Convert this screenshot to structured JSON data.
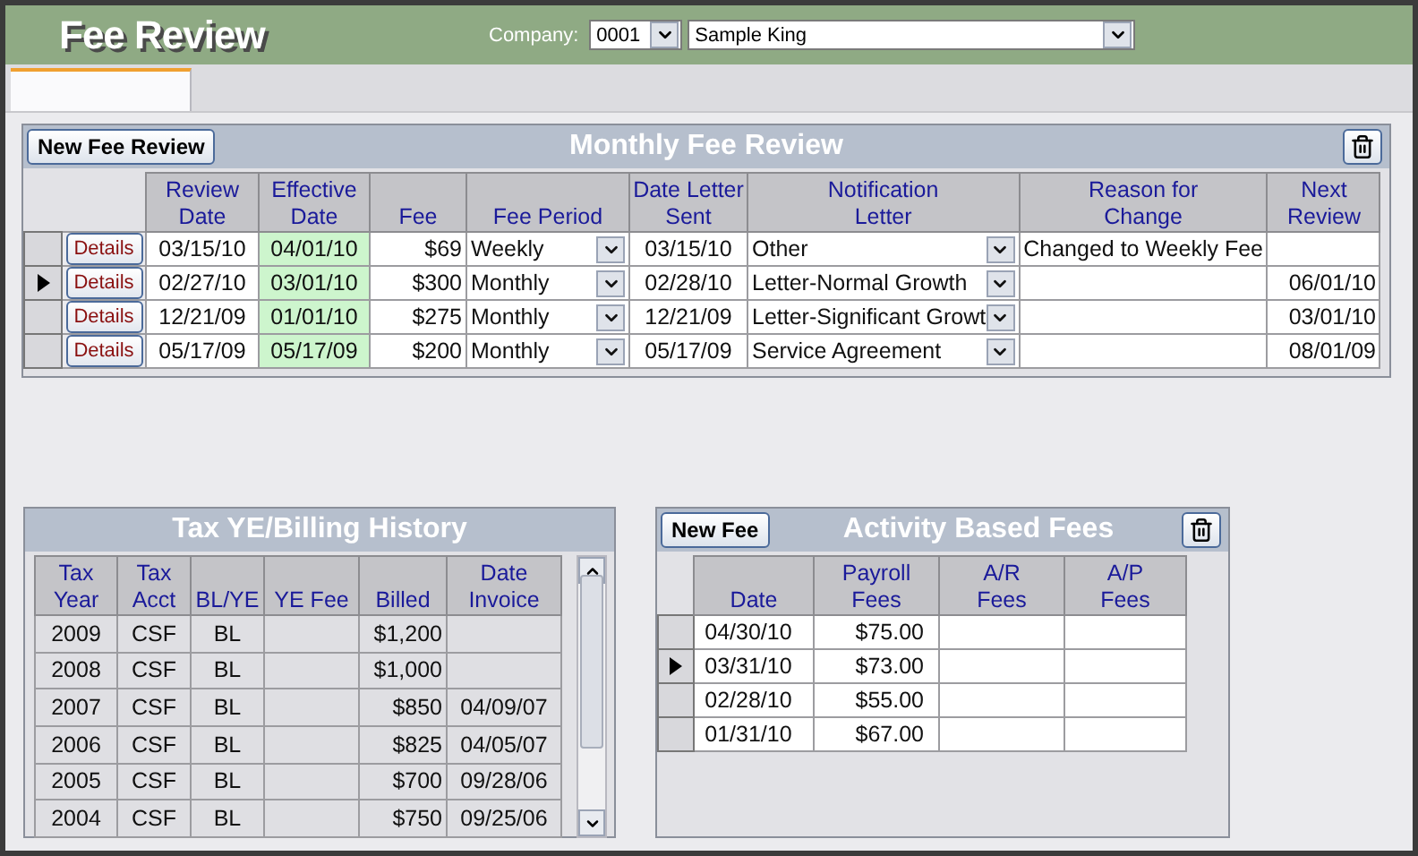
{
  "app_title": "Fee Review",
  "company": {
    "label": "Company:",
    "code": "0001",
    "name": "Sample King"
  },
  "tabs": [
    {
      "selected": true
    }
  ],
  "monthly_fee_review": {
    "title": "Monthly Fee Review",
    "new_button": "New Fee Review",
    "columns": [
      "Review\nDate",
      "Effective\nDate",
      "Fee",
      "Fee Period",
      "Date Letter\nSent",
      "Notification\nLetter",
      "Reason for\nChange",
      "Next\nReview"
    ],
    "rows": [
      {
        "current": false,
        "details": "Details",
        "review_date": "03/15/10",
        "effective_date": "04/01/10",
        "fee": "$69",
        "fee_period": "Weekly",
        "date_letter_sent": "03/15/10",
        "notification_letter": "Other",
        "reason": "Changed to Weekly Fee",
        "next_review": ""
      },
      {
        "current": true,
        "details": "Details",
        "review_date": "02/27/10",
        "effective_date": "03/01/10",
        "fee": "$300",
        "fee_period": "Monthly",
        "date_letter_sent": "02/28/10",
        "notification_letter": "Letter-Normal Growth",
        "reason": "",
        "next_review": "06/01/10"
      },
      {
        "current": false,
        "details": "Details",
        "review_date": "12/21/09",
        "effective_date": "01/01/10",
        "fee": "$275",
        "fee_period": "Monthly",
        "date_letter_sent": "12/21/09",
        "notification_letter": "Letter-Significant Growt",
        "reason": "",
        "next_review": "03/01/10"
      },
      {
        "current": false,
        "details": "Details",
        "review_date": "05/17/09",
        "effective_date": "05/17/09",
        "fee": "$200",
        "fee_period": "Monthly",
        "date_letter_sent": "05/17/09",
        "notification_letter": "Service Agreement",
        "reason": "",
        "next_review": "08/01/09"
      }
    ]
  },
  "billing_history": {
    "title": "Tax YE/Billing History",
    "columns": [
      "Tax\nYear",
      "Tax\nAcct",
      "BL/YE",
      "YE Fee",
      "Billed",
      "Date\nInvoice"
    ],
    "rows": [
      [
        "2009",
        "CSF",
        "BL",
        "",
        "$1,200",
        ""
      ],
      [
        "2008",
        "CSF",
        "BL",
        "",
        "$1,000",
        ""
      ],
      [
        "2007",
        "CSF",
        "BL",
        "",
        "$850",
        "04/09/07"
      ],
      [
        "2006",
        "CSF",
        "BL",
        "",
        "$825",
        "04/05/07"
      ],
      [
        "2005",
        "CSF",
        "BL",
        "",
        "$700",
        "09/28/06"
      ],
      [
        "2004",
        "CSF",
        "BL",
        "",
        "$750",
        "09/25/06"
      ]
    ]
  },
  "activity_fees": {
    "title": "Activity Based Fees",
    "new_button": "New Fee",
    "columns": [
      "Date",
      "Payroll\nFees",
      "A/R\nFees",
      "A/P\nFees"
    ],
    "rows": [
      {
        "current": false,
        "cells": [
          "04/30/10",
          "$75.00",
          "",
          ""
        ]
      },
      {
        "current": true,
        "cells": [
          "03/31/10",
          "$73.00",
          "",
          ""
        ]
      },
      {
        "current": false,
        "cells": [
          "02/28/10",
          "$55.00",
          "",
          ""
        ]
      },
      {
        "current": false,
        "cells": [
          "01/31/10",
          "$67.00",
          "",
          ""
        ]
      }
    ]
  }
}
